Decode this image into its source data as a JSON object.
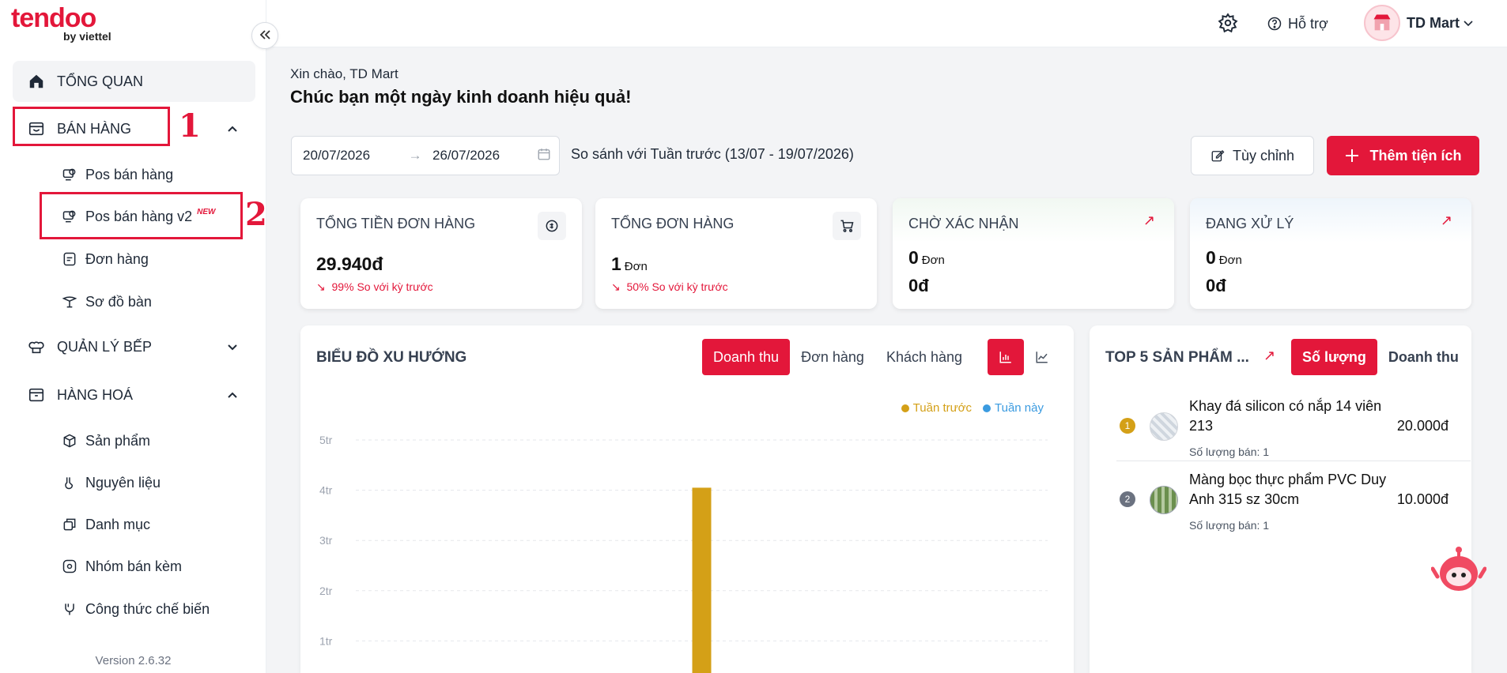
{
  "brand": {
    "name": "tendoo",
    "sub": "by viettel",
    "color": "#e3173a"
  },
  "sidebar": {
    "collapse_icon": "double-chevron-left-icon",
    "version": "Version 2.6.32",
    "items": [
      {
        "label": "TỔNG QUAN",
        "icon": "home-icon"
      },
      {
        "label": "BÁN HÀNG",
        "icon": "store-icon",
        "expanded": true
      },
      {
        "label": "QUẢN LÝ BẾP",
        "icon": "chef-hat-icon",
        "expanded": false
      },
      {
        "label": "HÀNG HOÁ",
        "icon": "box-icon",
        "expanded": true
      }
    ],
    "sales_sub": [
      {
        "label": "Pos bán hàng",
        "icon": "pos-icon"
      },
      {
        "label": "Pos bán hàng v2",
        "icon": "pos-icon",
        "badge": "NEW"
      },
      {
        "label": "Đơn hàng",
        "icon": "order-icon"
      },
      {
        "label": "Sơ đồ bàn",
        "icon": "table-icon"
      }
    ],
    "goods_sub": [
      {
        "label": "Sản phẩm",
        "icon": "cube-icon"
      },
      {
        "label": "Nguyên liệu",
        "icon": "ingredient-icon"
      },
      {
        "label": "Danh mục",
        "icon": "category-icon"
      },
      {
        "label": "Nhóm bán kèm",
        "icon": "bundle-icon"
      },
      {
        "label": "Công thức chế biến",
        "icon": "recipe-icon"
      }
    ],
    "annotations": [
      "1",
      "2"
    ]
  },
  "header": {
    "help": "Hỗ trợ",
    "user": "TD Mart"
  },
  "greeting": {
    "line1": "Xin chào, TD Mart",
    "line2": "Chúc bạn một ngày kinh doanh hiệu quả!"
  },
  "filter": {
    "date_from": "20/07/2026",
    "date_to": "26/07/2026",
    "compare": "So sánh với Tuần trước (13/07 - 19/07/2026)",
    "custom_btn": "Tùy chỉnh",
    "add_btn": "Thêm tiện ích"
  },
  "cards": [
    {
      "title": "TỔNG TIỀN ĐƠN HÀNG",
      "value": "29.940đ",
      "change": "99%",
      "change_label": "So với kỳ trước"
    },
    {
      "title": "TỔNG ĐƠN HÀNG",
      "value": "1",
      "unit": "Đơn",
      "change": "50%",
      "change_label": "So với kỳ trước"
    },
    {
      "title": "CHỜ XÁC NHẬN",
      "value": "0",
      "unit": "Đơn",
      "amount": "0đ"
    },
    {
      "title": "ĐANG XỬ LÝ",
      "value": "0",
      "unit": "Đơn",
      "amount": "0đ"
    }
  ],
  "trend": {
    "title": "BIỂU ĐỒ XU HƯỚNG",
    "tabs": [
      "Doanh thu",
      "Đơn hàng",
      "Khách hàng"
    ],
    "active_tab": 0
  },
  "chart_data": {
    "type": "bar",
    "series": [
      {
        "name": "Tuần trước",
        "color": "#d4a017"
      },
      {
        "name": "Tuần này",
        "color": "#3b9be0"
      }
    ],
    "y_ticks": [
      "5tr",
      "4tr",
      "3tr",
      "2tr",
      "1tr"
    ],
    "ylim": [
      0,
      5
    ],
    "bars": [
      {
        "series": "Tuần trước",
        "slot": 3,
        "value": 4.05
      }
    ],
    "slots": 7
  },
  "top5": {
    "title": "TOP 5 SẢN PHẨM ...",
    "tabs": [
      "Số lượng",
      "Doanh thu"
    ],
    "active_tab": 0,
    "products": [
      {
        "rank": "1",
        "name": "Khay đá silicon có nắp 14 viên 213",
        "sold": "Số lượng bán: 1",
        "price": "20.000đ",
        "rank_color": "#d4a017"
      },
      {
        "rank": "2",
        "name": "Màng bọc thực phẩm PVC Duy Anh 315 sz 30cm",
        "sold": "Số lượng bán: 1",
        "price": "10.000đ",
        "rank_color": "#6b7280"
      }
    ]
  }
}
